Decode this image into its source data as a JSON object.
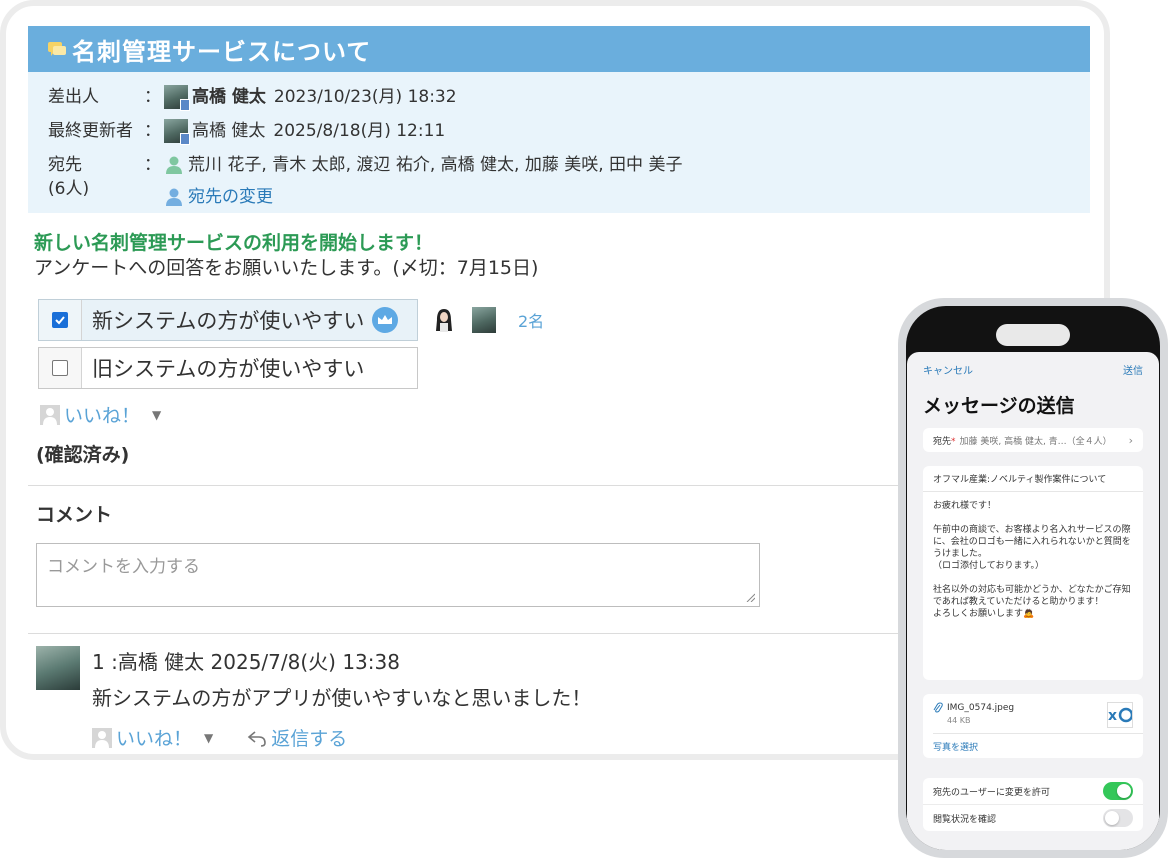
{
  "message": {
    "title": "名刺管理サービスについて",
    "sender_label": "差出人",
    "sender_name": "高橋 健太",
    "sender_date": "2023/10/23(月) 18:32",
    "updater_label": "最終更新者",
    "updater_name": "高橋 健太",
    "updater_date": "2025/8/18(月) 12:11",
    "recipients_label": "宛先",
    "recipients_count": "(6人)",
    "recipients": "荒川 花子, 青木 太郎, 渡辺 祐介, 高橋 健太, 加藤 美咲, 田中 美子",
    "change_recipients": "宛先の変更",
    "colon": "：",
    "headline": "新しい名刺管理サービスの利用を開始します！",
    "subtext": "アンケートへの回答をお願いいたします。(〆切：7月15日)"
  },
  "poll": {
    "options": [
      {
        "label": "新システムの方が使いやすい",
        "checked": true,
        "votes": "2名"
      },
      {
        "label": "旧システムの方が使いやすい",
        "checked": false
      }
    ]
  },
  "like": {
    "label": "いいね！"
  },
  "confirmed": "(確認済み)",
  "comment": {
    "heading": "コメント",
    "placeholder": "コメントを入力する"
  },
  "post": {
    "header": "1 :高橋 健太  2025/7/8(火) 13:38",
    "text": "新システムの方がアプリが使いやすいなと思いました！",
    "like": "いいね！",
    "reply": "返信する"
  },
  "phone": {
    "cancel": "キャンセル",
    "send": "送信",
    "title": "メッセージの送信",
    "to_label": "宛先",
    "to_required": "*",
    "to_value": "加藤 美咲, 高橋 健太, 青…（全４人）",
    "subject": "オフマル産業:ノベルティ製作案件について",
    "body": "お疲れ様です！\n\n午前中の商談で、お客様より名入れサービスの際に、会社のロゴも一緒に入れられないかと質問をうけました。\n（ロゴ添付しております。）\n\n社名以外の対応も可能かどうか、どなたかご存知であれば教えていただけると助かります！\nよろしくお願いします🙇",
    "attachment_name": "IMG_0574.jpeg",
    "attachment_size": "44 KB",
    "select_photo": "写真を選択",
    "toggles": [
      {
        "label": "宛先のユーザーに変更を許可",
        "on": true
      },
      {
        "label": "閲覧状況を確認",
        "on": false
      }
    ]
  },
  "colors": {
    "title_bar": "#6aaedd",
    "meta_bg": "#e9f4fb",
    "headline": "#2c9a55",
    "link": "#2a7ab8",
    "toggle_on": "#34c759"
  }
}
